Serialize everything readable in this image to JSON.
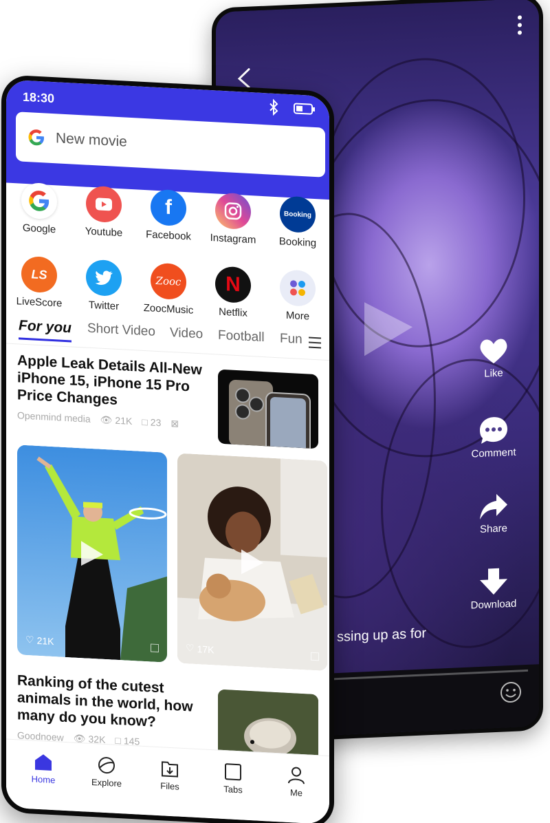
{
  "back_phone": {
    "subtitle": "ssing up as for",
    "actions": [
      {
        "label": "Like",
        "icon": "heart-icon"
      },
      {
        "label": "Comment",
        "icon": "comment-icon"
      },
      {
        "label": "Share",
        "icon": "share-icon"
      },
      {
        "label": "Download",
        "icon": "download-icon"
      }
    ],
    "progress_fraction": 0.04
  },
  "status": {
    "time": "18:30"
  },
  "search": {
    "text": "New movie"
  },
  "shortcuts": [
    {
      "label": "Google",
      "icon": "google-icon",
      "color": "#ffffff"
    },
    {
      "label": "Youtube",
      "icon": "youtube-icon",
      "color": "#ef5350"
    },
    {
      "label": "Facebook",
      "icon": "facebook-icon",
      "color": "#1877f2"
    },
    {
      "label": "Instagram",
      "icon": "instagram-icon",
      "color": "#d6249f"
    },
    {
      "label": "Booking",
      "icon": "booking-icon",
      "color": "#003b95"
    },
    {
      "label": "LiveScore",
      "icon": "livescore-icon",
      "color": "#f26b21"
    },
    {
      "label": "Twitter",
      "icon": "twitter-icon",
      "color": "#1da1f2"
    },
    {
      "label": "ZoocMusic",
      "icon": "zoocmusic-icon",
      "color": "#f04e1e"
    },
    {
      "label": "Netflix",
      "icon": "netflix-icon",
      "color": "#111111"
    },
    {
      "label": "More",
      "icon": "more-apps-icon",
      "color": "#e9ecf7"
    }
  ],
  "shortcut_glyphs": {
    "booking": "Booking",
    "livescore": "LS",
    "zooc": "Zooc",
    "netflix": "N",
    "facebook": "f",
    "google": "G"
  },
  "tabs": [
    "For you",
    "Short Video",
    "Video",
    "Football",
    "Fun"
  ],
  "articles": [
    {
      "title": "Apple Leak Details All-New iPhone 15, iPhone 15 Pro Price Changes",
      "source": "Openmind media",
      "views": "21K",
      "comments": "23"
    },
    {
      "title": "Ranking of the cutest animals in the world, how many do you know?",
      "source": "Goodnoew",
      "views": "32K",
      "comments": "145"
    }
  ],
  "video_cards": [
    {
      "likes": "21K"
    },
    {
      "likes": "17K"
    }
  ],
  "nav": [
    "Home",
    "Explore",
    "Files",
    "Tabs",
    "Me"
  ],
  "colors": {
    "accent": "#3b38e3"
  }
}
